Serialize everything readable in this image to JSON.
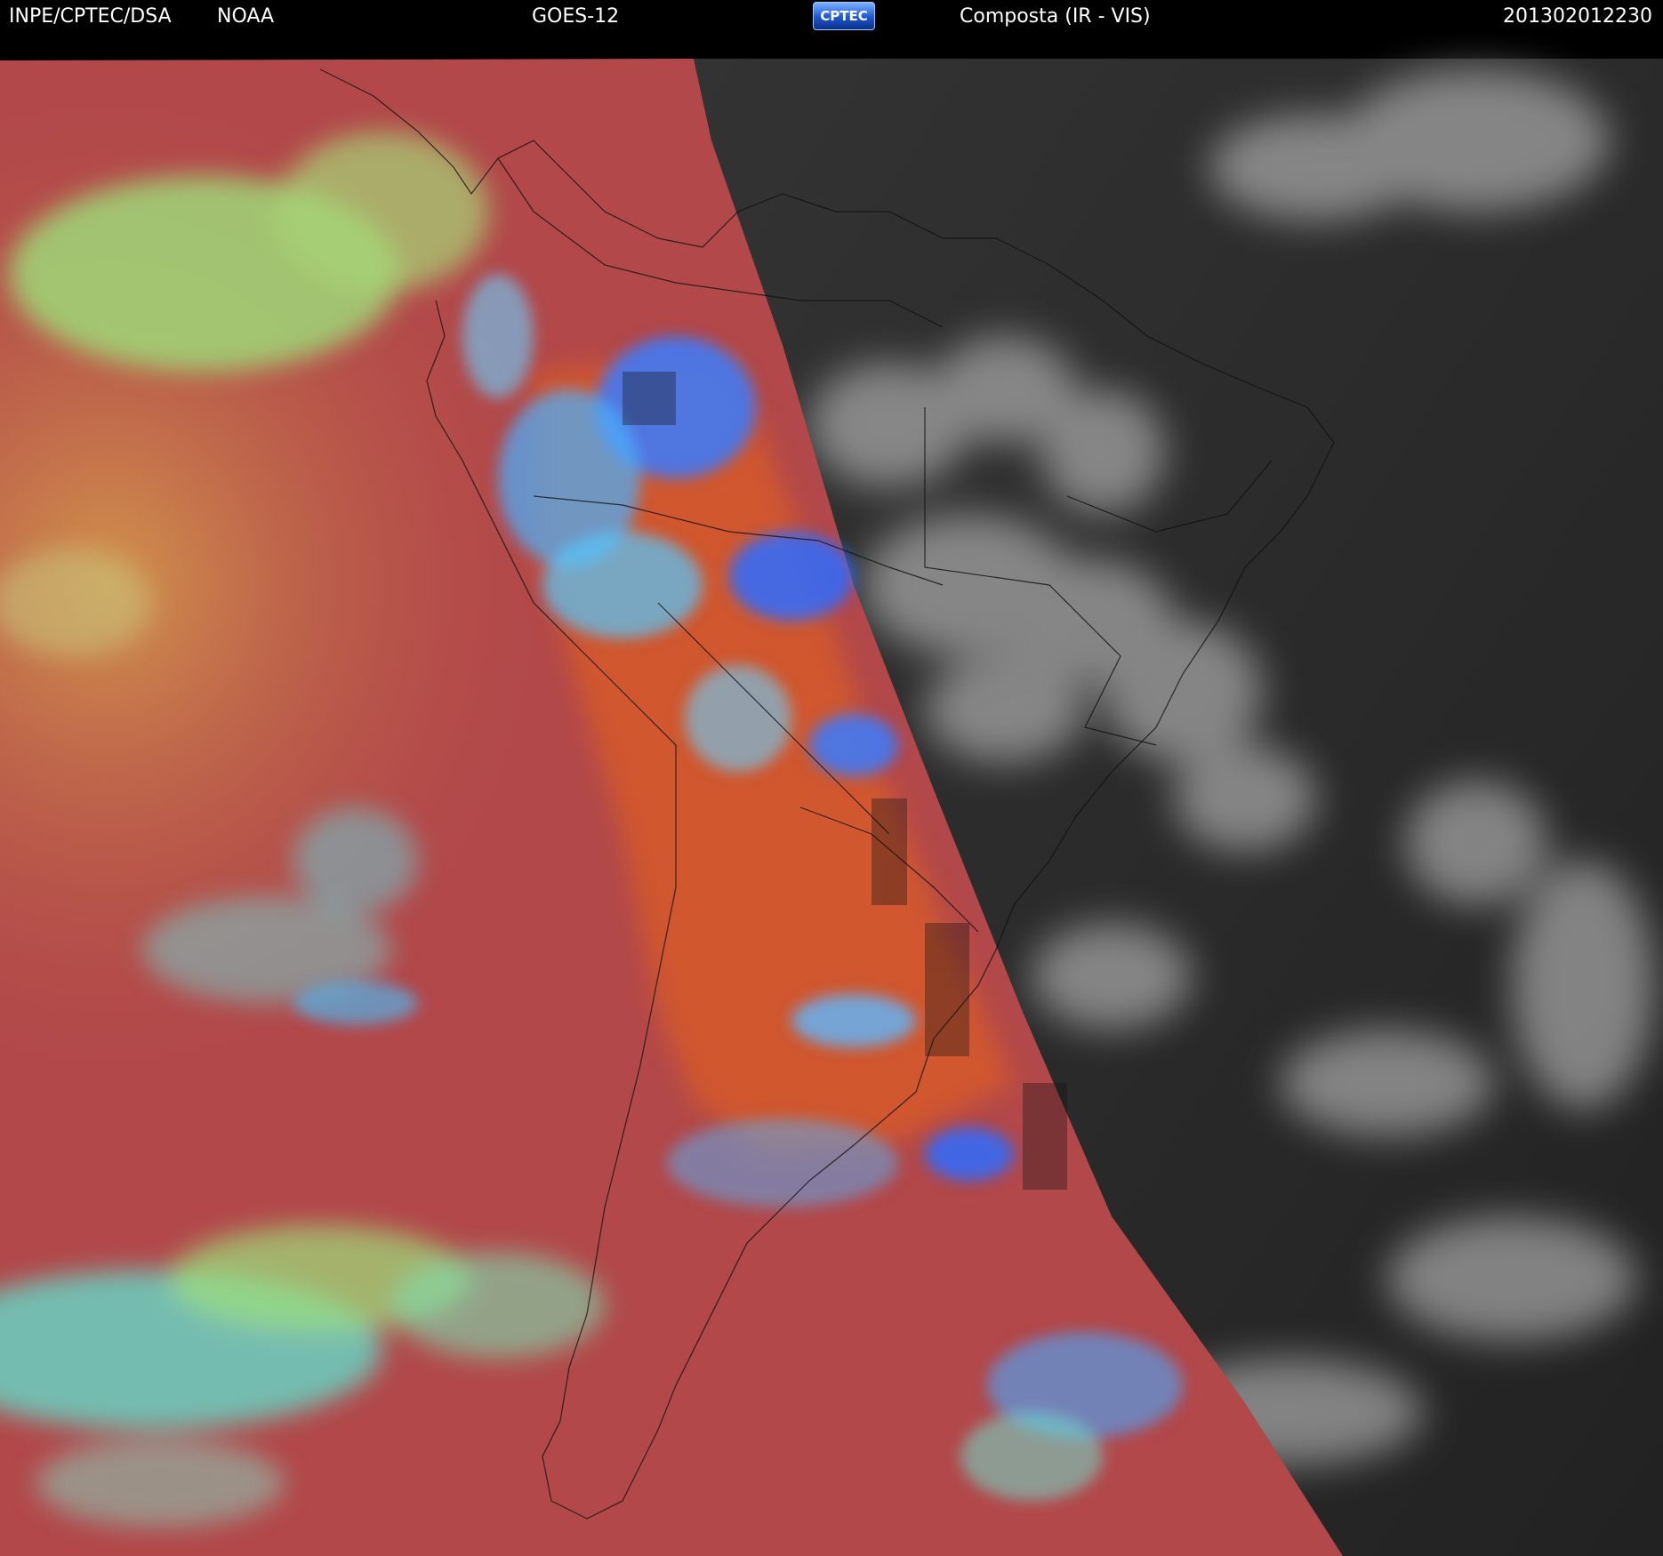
{
  "header": {
    "agency": "INPE/CPTEC/DSA",
    "provider": "NOAA",
    "satellite": "GOES-12",
    "logo_text": "CPTEC",
    "product": "Composta (IR - VIS)",
    "timestamp": "201302012230"
  },
  "map": {
    "region": "South America",
    "left_panel_palette": "false-color infrared (red / green / cyan / blue)",
    "right_panel_palette": "grayscale visible",
    "colors": {
      "ocean_red": "#b2484a",
      "land_orange": "#d65a2a",
      "cloud_green": "#9ee07a",
      "cloud_cyan": "#5fe3d2",
      "cloud_blue": "#3a7bff",
      "vis_background": "#2c2c2c",
      "vis_cloud": "#d8d8d8",
      "outline": "#111111"
    }
  }
}
